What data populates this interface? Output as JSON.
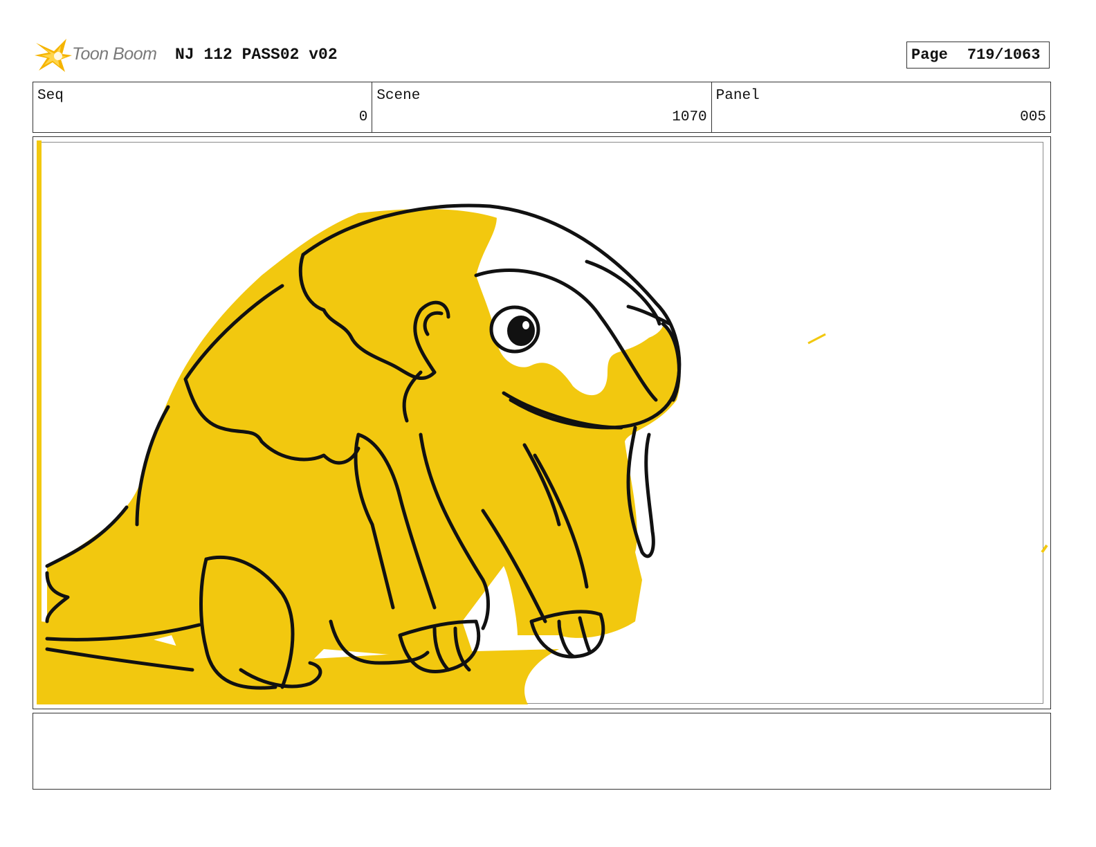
{
  "header": {
    "logo_text": "Toon Boom",
    "title": "NJ 112 PASS02 v02",
    "page_label": "Page",
    "page_number": "719/1063"
  },
  "info": {
    "seq_label": "Seq",
    "seq_value": "0",
    "scene_label": "Scene",
    "scene_value": "1070",
    "panel_label": "Panel",
    "panel_value": "005"
  },
  "colors": {
    "fill_yellow": "#f2c80f",
    "logo_orange": "#f5b400",
    "ink": "#111111"
  },
  "notes": ""
}
